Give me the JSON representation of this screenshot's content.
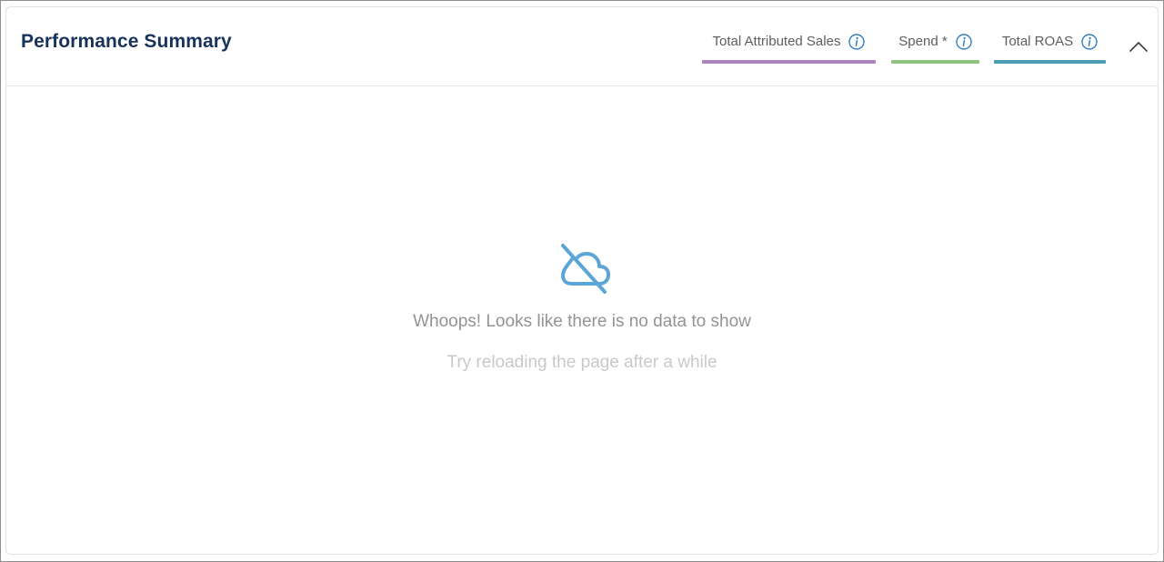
{
  "panel": {
    "title": "Performance Summary"
  },
  "legend": [
    {
      "label": "Total Attributed Sales",
      "color": "#a883bd",
      "icon": "info-icon"
    },
    {
      "label": "Spend *",
      "color": "#8ec27e",
      "icon": "info-icon"
    },
    {
      "label": "Total ROAS",
      "color": "#4a9db4",
      "icon": "info-icon"
    }
  ],
  "collapse": {
    "icon": "chevron-up-icon"
  },
  "empty_state": {
    "icon": "cloud-off-icon",
    "icon_color": "#5ba6d6",
    "message": "Whoops! Looks like there is no data to show",
    "hint": "Try reloading the page after a while"
  }
}
